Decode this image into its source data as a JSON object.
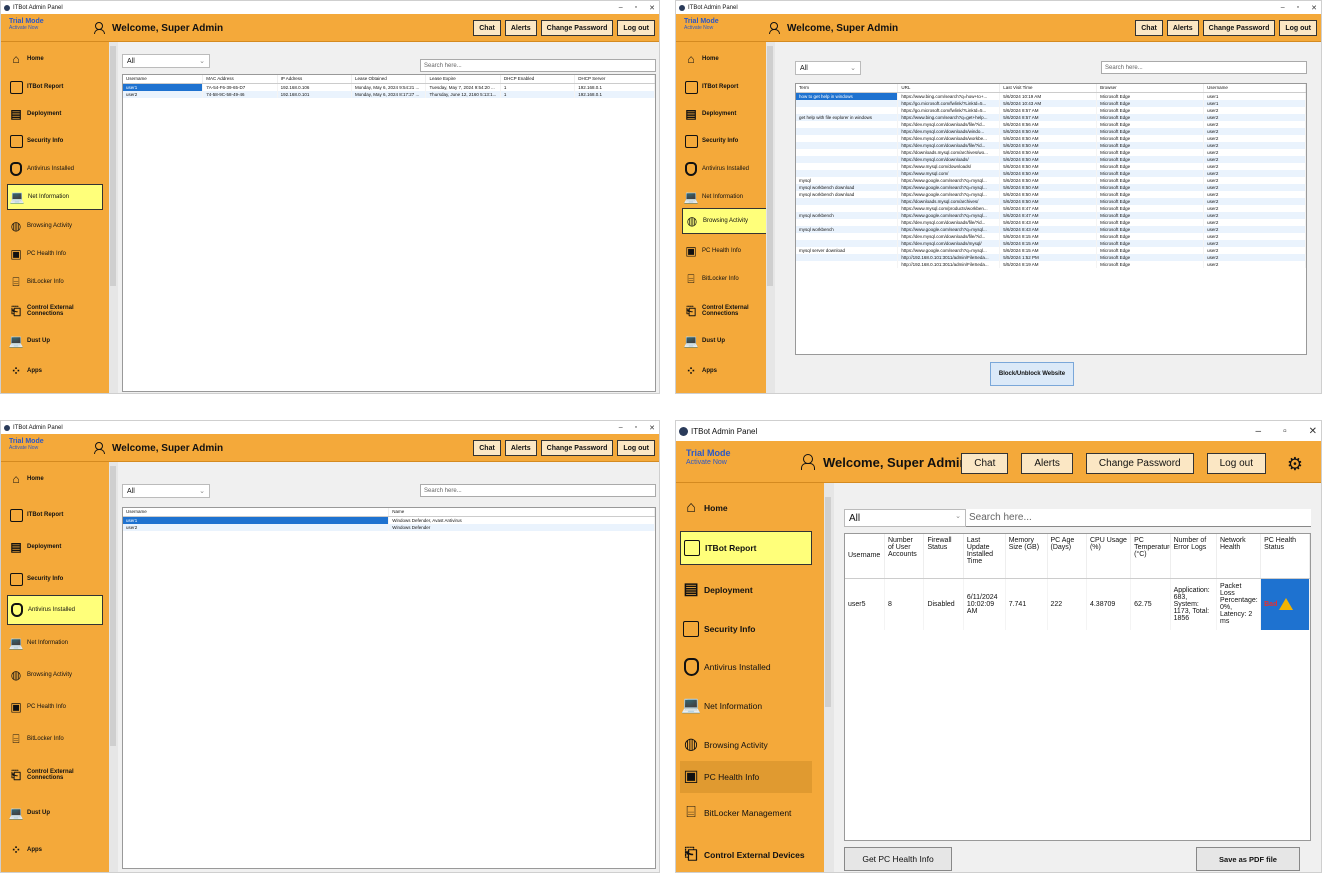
{
  "app": {
    "title": "ITBot Admin Panel",
    "trial": "Trial Mode",
    "activate": "Activate Now",
    "welcome": "Welcome, Super Admin",
    "buttons": {
      "chat": "Chat",
      "alerts": "Alerts",
      "change_password": "Change Password",
      "logout": "Log out"
    }
  },
  "sidebar": {
    "home": "Home",
    "itbot_report": "ITBot Report",
    "deployment": "Deployment",
    "security_info": "Security Info",
    "antivirus": "Antivirus Installed",
    "net_info": "Net Information",
    "browsing": "Browsing Activity",
    "pc_health": "PC Health Info",
    "bitlocker": "BitLocker Info",
    "bitlocker_mgmt": "BitLocker Management",
    "control_ext": "Control External Connections",
    "control_ext_devices": "Control External Devices",
    "dust_up": "Dust Up",
    "apps": "Apps"
  },
  "filter": {
    "all": "All",
    "search_placeholder": "Search here..."
  },
  "net_info": {
    "columns": [
      "Username",
      "MAC Address",
      "IP Address",
      "Lease Obtained",
      "Lease Expire",
      "DHCP Enabled",
      "DHCP Server"
    ],
    "rows": [
      [
        "user1",
        "7A-54-F6-39-65-D7",
        "192.168.0.106",
        "Monday, May 6, 2024 9:54:21 ...",
        "Tuesday, May 7, 2024 9:54:20 ...",
        "1",
        "192.168.0.1"
      ],
      [
        "user2",
        "74-58-9C-58-49-46",
        "192.168.0.101",
        "Monday, May 6, 2024 8:17:27 ...",
        "Thursday, June 12, 2160 5:13:1...",
        "1",
        "192.168.0.1"
      ]
    ]
  },
  "browsing": {
    "columns": [
      "Term",
      "URL",
      "Last Visit Time",
      "Browser",
      "Username"
    ],
    "rows": [
      [
        "how to get help in windows",
        "https://www.bing.com/search?q=how+to+...",
        "5/6/2024 10:19 AM",
        "Microsoft Edge",
        "user1"
      ],
      [
        "",
        "https://go.microsoft.com/fwlink/?LinkId=5...",
        "5/6/2024 10:43 AM",
        "Microsoft Edge",
        "user1"
      ],
      [
        "",
        "https://go.microsoft.com/fwlink/?LinkId=5...",
        "5/6/2024 8:57 AM",
        "Microsoft Edge",
        "user2"
      ],
      [
        "get help with file explorer in windows",
        "https://www.bing.com/search?q=get+help...",
        "5/6/2024 8:57 AM",
        "Microsoft Edge",
        "user2"
      ],
      [
        "",
        "https://dev.mysql.com/downloads/file/?id...",
        "5/6/2024 8:56 AM",
        "Microsoft Edge",
        "user2"
      ],
      [
        "",
        "https://dev.mysql.com/downloads/windo...",
        "5/6/2024 8:50 AM",
        "Microsoft Edge",
        "user2"
      ],
      [
        "",
        "https://dev.mysql.com/downloads/workbe...",
        "5/6/2024 8:50 AM",
        "Microsoft Edge",
        "user2"
      ],
      [
        "",
        "https://dev.mysql.com/downloads/file/?id...",
        "5/6/2024 8:50 AM",
        "Microsoft Edge",
        "user2"
      ],
      [
        "",
        "https://downloads.mysql.com/archives/wo...",
        "5/6/2024 8:50 AM",
        "Microsoft Edge",
        "user2"
      ],
      [
        "",
        "https://dev.mysql.com/downloads/",
        "5/6/2024 8:50 AM",
        "Microsoft Edge",
        "user2"
      ],
      [
        "",
        "https://www.mysql.com/downloads/",
        "5/6/2024 8:50 AM",
        "Microsoft Edge",
        "user2"
      ],
      [
        "",
        "https://www.mysql.com/",
        "5/6/2024 8:50 AM",
        "Microsoft Edge",
        "user2"
      ],
      [
        "mysql",
        "https://www.google.com/search?q=mysql...",
        "5/6/2024 8:50 AM",
        "Microsoft Edge",
        "user2"
      ],
      [
        "mysql workbench download",
        "https://www.google.com/search?q=mysql...",
        "5/6/2024 8:50 AM",
        "Microsoft Edge",
        "user2"
      ],
      [
        "mysql workbench download",
        "https://www.google.com/search?q=mysql...",
        "5/6/2024 8:50 AM",
        "Microsoft Edge",
        "user2"
      ],
      [
        "",
        "https://downloads.mysql.com/archives/",
        "5/6/2024 8:50 AM",
        "Microsoft Edge",
        "user2"
      ],
      [
        "",
        "https://www.mysql.com/products/workben...",
        "5/6/2024 8:47 AM",
        "Microsoft Edge",
        "user2"
      ],
      [
        "mysql workbench",
        "https://www.google.com/search?q=mysql...",
        "5/6/2024 8:47 AM",
        "Microsoft Edge",
        "user2"
      ],
      [
        "",
        "https://dev.mysql.com/downloads/file/?id...",
        "5/6/2024 8:43 AM",
        "Microsoft Edge",
        "user2"
      ],
      [
        "mysql workbench",
        "https://www.google.com/search?q=mysql...",
        "5/6/2024 8:43 AM",
        "Microsoft Edge",
        "user2"
      ],
      [
        "",
        "https://dev.mysql.com/downloads/file/?id...",
        "5/6/2024 8:15 AM",
        "Microsoft Edge",
        "user2"
      ],
      [
        "",
        "https://dev.mysql.com/downloads/mysql/",
        "5/6/2024 8:15 AM",
        "Microsoft Edge",
        "user2"
      ],
      [
        "mysql server download",
        "https://www.google.com/search?q=mysql...",
        "5/6/2024 8:15 AM",
        "Microsoft Edge",
        "user2"
      ],
      [
        "",
        "http://192.168.0.101:3011/admin/FileSeda...",
        "5/5/2024 1:52 PM",
        "Microsoft Edge",
        "user2"
      ],
      [
        "",
        "http://192.168.0.101:3011/admin/FileSeda...",
        "5/5/2024 8:19 AM",
        "Microsoft Edge",
        "user2"
      ]
    ],
    "block_button": "Block/Unblock Website"
  },
  "antivirus": {
    "columns": [
      "Username",
      "Name"
    ],
    "rows": [
      [
        "user1",
        "Windows Defender, Avast Antivirus"
      ],
      [
        "user2",
        "Windows Defender"
      ]
    ]
  },
  "pc_health": {
    "columns": [
      "Username",
      "Number of User Accounts",
      "Firewall Status",
      "Last Update Installed Time",
      "Memory Size (GB)",
      "PC Age (Days)",
      "CPU Usage (%)",
      "PC Temperature (°C)",
      "Number of Error Logs",
      "Network Health",
      "PC Health Status"
    ],
    "rows": [
      [
        "user5",
        "8",
        "Disabled",
        "6/11/2024 10:02:09 AM",
        "7.741",
        "222",
        "4.38709",
        "62.75",
        "Application: 683, System: 1173, Total: 1856",
        "Packet Loss Percentage: 0%, Latency: 2 ms",
        "Bad"
      ]
    ],
    "get_button": "Get PC Health Info",
    "pdf_button": "Save as PDF file"
  }
}
